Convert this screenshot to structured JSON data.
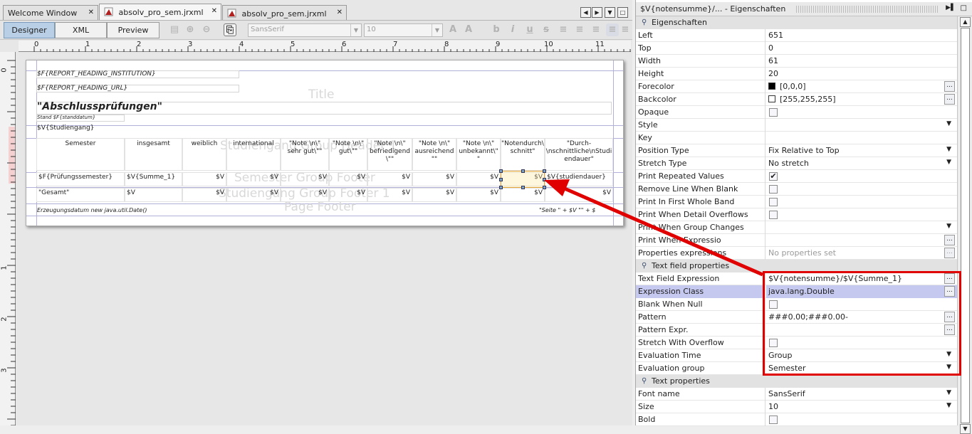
{
  "tabs": [
    {
      "label": "Welcome Window"
    },
    {
      "label": "absolv_pro_sem.jrxml"
    },
    {
      "label": "absolv_pro_sem.jrxml"
    }
  ],
  "toolbar": {
    "designer": "Designer",
    "xml": "XML",
    "preview": "Preview",
    "font": "SansSerif",
    "size": "10"
  },
  "ruler": {
    "h": [
      "0",
      "1",
      "2",
      "3",
      "4",
      "5",
      "6",
      "7",
      "8",
      "9",
      "10",
      "11"
    ],
    "v": [
      "0",
      "1",
      "2",
      "3"
    ]
  },
  "report": {
    "heading_institution": "$F{REPORT_HEADING_INSTITUTION}",
    "heading_url": "$F{REPORT_HEADING_URL}",
    "title_label": "Title",
    "title_text": "\"Abschlussprüfungen\"",
    "stand": "Stand $F{standdatum}",
    "studiengang": "$V{Studiengang}",
    "band_studiengang": "Studiengang Group Header 1",
    "band_semester_footer": "Semester Group Footer",
    "band_studiengang_footer": "Studiengang Group Footer 1",
    "band_page_footer": "Page Footer",
    "headers": [
      "Semester",
      "insgesamt",
      "weiblich",
      "international",
      "\"Note \\n\\\" sehr gut\\\"\"",
      "\"Note \\n\\\" gut\\\"\"",
      "\"Note \\n\\\" befriedigend \\\"\"",
      "\"Note \\n\\\" ausreichend \"\"",
      "\"Note \\n\\\" unbekannt\\\" \"",
      "\"Notendurch\\n-schnitt\"",
      "\"Durch- \\nschnittliche\\nStudi endauer\""
    ],
    "row1": [
      "$F{Prüfungssemester}",
      "$V{Summe_1}",
      "$V",
      "$V",
      "$V",
      "$V",
      "$V",
      "$V",
      "$V",
      "$V",
      "$V{studiendauer}"
    ],
    "row2": [
      "\"Gesamt\"",
      "$V",
      "$V",
      "$V",
      "$V",
      "$V",
      "$V",
      "$V",
      "$V",
      "$V",
      "$V"
    ],
    "footer_left": "Erzeugungsdatum new java.util.Date()",
    "footer_right": "\"Seite \" + $V \"\" + $"
  },
  "panel": {
    "title": "$V{notensumme}/... - Eigenschaften"
  },
  "sections": {
    "eigenschaften": "Eigenschaften",
    "text_field": "Text field properties",
    "text": "Text properties"
  },
  "props": [
    {
      "name": "Left",
      "value": "651"
    },
    {
      "name": "Top",
      "value": "0"
    },
    {
      "name": "Width",
      "value": "61"
    },
    {
      "name": "Height",
      "value": "20"
    },
    {
      "name": "Forecolor",
      "value": "[0,0,0]",
      "swatch": "#000000"
    },
    {
      "name": "Backcolor",
      "value": "[255,255,255]",
      "swatch": "#ffffff"
    },
    {
      "name": "Opaque",
      "value": ""
    },
    {
      "name": "Style",
      "value": ""
    },
    {
      "name": "Key",
      "value": ""
    },
    {
      "name": "Position Type",
      "value": "Fix Relative to Top"
    },
    {
      "name": "Stretch Type",
      "value": "No stretch"
    },
    {
      "name": "Print Repeated Values",
      "value": "✔"
    },
    {
      "name": "Remove Line When Blank",
      "value": ""
    },
    {
      "name": "Print In First Whole Band",
      "value": ""
    },
    {
      "name": "Print When Detail Overflows",
      "value": ""
    },
    {
      "name": "Print When Group Changes",
      "value": ""
    },
    {
      "name": "Print When Expressio",
      "value": ""
    },
    {
      "name": "Properties expressions",
      "value": "No properties set"
    }
  ],
  "tfprops": [
    {
      "name": "Text Field Expression",
      "value": "$V{notensumme}/$V{Summe_1}"
    },
    {
      "name": "Expression Class",
      "value": "java.lang.Double"
    },
    {
      "name": "Blank When Null",
      "value": ""
    },
    {
      "name": "Pattern",
      "value": "###0.00;###0.00-"
    },
    {
      "name": "Pattern Expr.",
      "value": ""
    },
    {
      "name": "Stretch With Overflow",
      "value": ""
    },
    {
      "name": "Evaluation Time",
      "value": "Group"
    },
    {
      "name": "Evaluation group",
      "value": "Semester"
    }
  ],
  "tprops": [
    {
      "name": "Font name",
      "value": "SansSerif"
    },
    {
      "name": "Size",
      "value": "10"
    },
    {
      "name": "Bold",
      "value": ""
    }
  ],
  "colors": {
    "annotation_red": "#e00000",
    "selection": "#f0c060",
    "highlight_row": "#c6c9ef"
  }
}
